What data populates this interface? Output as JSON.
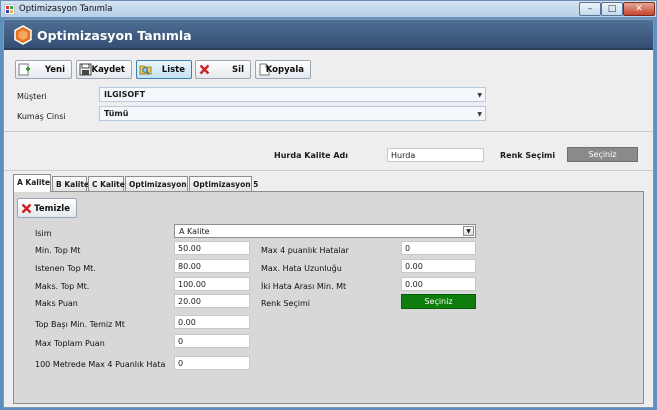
{
  "window": {
    "title": "Optimizasyon Tanımla",
    "controls": {
      "minimize": "–",
      "maximize": "□",
      "close": "✕"
    }
  },
  "header": {
    "title": "Optimizasyon Tanımla",
    "icon": "hexagon-logo-icon",
    "accent": "#e8731f"
  },
  "toolbar": {
    "new_label": "Yeni",
    "save_label": "Kaydet",
    "list_label": "Liste",
    "delete_label": "Sil",
    "copy_label": "Kopyala"
  },
  "form": {
    "customer_label": "Müşteri",
    "customer_value": "ILGISOFT",
    "fabric_label": "Kumaş Cinsi",
    "fabric_value": "Tümü",
    "scrap_label": "Hurda Kalite Adı",
    "scrap_value": "Hurda",
    "color_label": "Renk Seçimi",
    "color_button": "Seçiniz"
  },
  "tabs": [
    "A Kalite",
    "B Kalite",
    "C Kalite",
    "Optimizasyon 4",
    "Optimizasyon 5"
  ],
  "panel": {
    "clear_label": "Temizle",
    "name_label": "Isim",
    "name_value": "A Kalite",
    "left_fields": [
      {
        "label": "Min. Top Mt",
        "value": "50.00"
      },
      {
        "label": "Istenen Top Mt.",
        "value": "80.00"
      },
      {
        "label": "Maks. Top Mt.",
        "value": "100.00"
      },
      {
        "label": "Maks Puan",
        "value": "20.00"
      },
      {
        "label": "Top Başı Min. Temiz Mt",
        "value": "0.00"
      },
      {
        "label": "Max Toplam Puan",
        "value": "0"
      },
      {
        "label": "100 Metrede Max 4 Puanlık Hata",
        "value": "0"
      }
    ],
    "right_fields": [
      {
        "label": "Max 4 puanlık Hatalar",
        "value": "0"
      },
      {
        "label": "Max. Hata Uzunluğu",
        "value": "0.00"
      },
      {
        "label": "İki Hata Arası Min. Mt",
        "value": "0.00"
      }
    ],
    "color_label": "Renk Seçimi",
    "color_button": "Seçiniz",
    "color_button_color": "#0e7d0e"
  }
}
